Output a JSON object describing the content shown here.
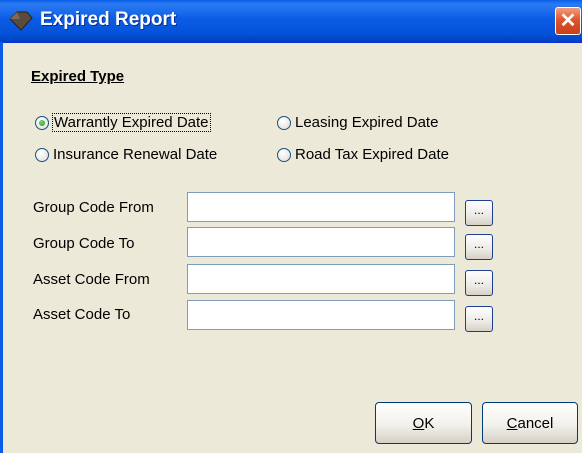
{
  "window": {
    "title": "Expired Report",
    "close_glyph": "✕",
    "title_icon": "diamond-app-icon"
  },
  "expired_type": {
    "heading": "Expired Type",
    "options": [
      {
        "label": "Warrantly Expired Date",
        "checked": true
      },
      {
        "label": "Leasing Expired Date",
        "checked": false
      },
      {
        "label": "Insurance Renewal Date",
        "checked": false
      },
      {
        "label": "Road Tax Expired Date",
        "checked": false
      }
    ]
  },
  "fields": [
    {
      "label": "Group Code From",
      "value": "",
      "browse": "..."
    },
    {
      "label": "Group Code To",
      "value": "",
      "browse": "..."
    },
    {
      "label": "Asset Code From",
      "value": "",
      "browse": "..."
    },
    {
      "label": "Asset Code To",
      "value": "",
      "browse": "..."
    }
  ],
  "buttons": {
    "ok_mnemonic": "O",
    "ok_rest": "K",
    "cancel_mnemonic": "C",
    "cancel_rest": "ancel"
  },
  "colors": {
    "titlebar": "#0b5ce6",
    "close": "#e0542e",
    "dialog_bg": "#ece9d8",
    "radio_checked": "#1f9a1f"
  }
}
